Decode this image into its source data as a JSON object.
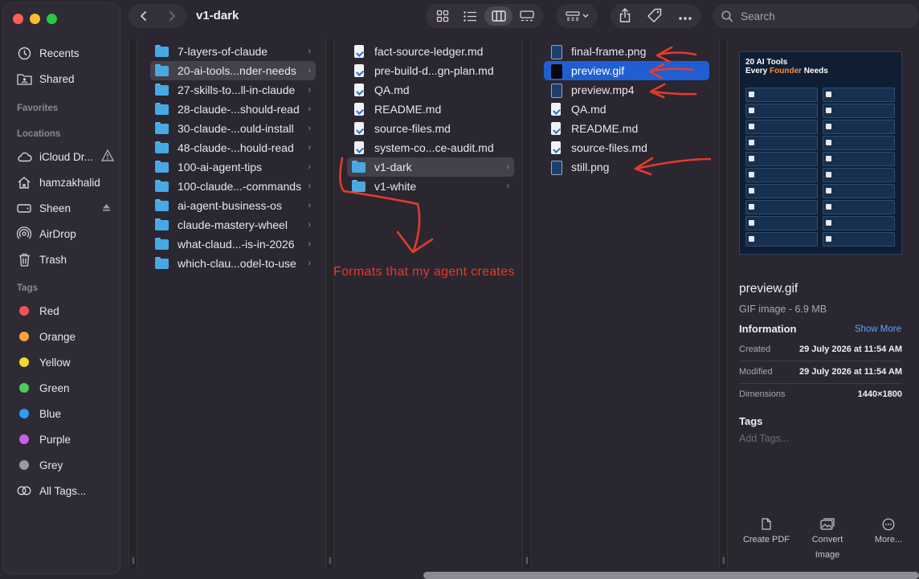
{
  "window": {
    "title": "v1-dark"
  },
  "toolbar": {
    "search_placeholder": "Search"
  },
  "sidebar": {
    "top": [
      {
        "label": "Recents",
        "icon": "clock-icon"
      },
      {
        "label": "Shared",
        "icon": "shared-folder-icon"
      }
    ],
    "favorites_header": "Favorites",
    "locations_header": "Locations",
    "locations": [
      {
        "label": "iCloud Dr...",
        "icon": "cloud-icon"
      },
      {
        "label": "hamzakhalid",
        "icon": "home-icon"
      },
      {
        "label": "Sheen",
        "icon": "drive-icon"
      },
      {
        "label": "AirDrop",
        "icon": "airdrop-icon"
      },
      {
        "label": "Trash",
        "icon": "trash-icon"
      }
    ],
    "tags_header": "Tags",
    "tags": [
      {
        "label": "Red",
        "color": "#f0545b"
      },
      {
        "label": "Orange",
        "color": "#f7a43b"
      },
      {
        "label": "Yellow",
        "color": "#f6d633"
      },
      {
        "label": "Green",
        "color": "#4bcf5a"
      },
      {
        "label": "Blue",
        "color": "#2f9df7"
      },
      {
        "label": "Purple",
        "color": "#c661e6"
      },
      {
        "label": "Grey",
        "color": "#9b99a1"
      }
    ],
    "all_tags": "All Tags..."
  },
  "columns": {
    "col1": [
      "7-layers-of-claude",
      "20-ai-tools...nder-needs",
      "27-skills-to...ll-in-claude",
      "28-claude-...should-read",
      "30-claude-...ould-install",
      "48-claude-...hould-read",
      "100-ai-agent-tips",
      "100-claude...-commands",
      "ai-agent-business-os",
      "claude-mastery-wheel",
      "what-claud...-is-in-2026",
      "which-clau...odel-to-use"
    ],
    "col2_files": [
      "fact-source-ledger.md",
      "pre-build-d...gn-plan.md",
      "QA.md",
      "README.md",
      "source-files.md",
      "system-co...ce-audit.md"
    ],
    "col2_folders": [
      "v1-dark",
      "v1-white"
    ],
    "col3": [
      {
        "name": "final-frame.png",
        "kind": "img"
      },
      {
        "name": "preview.gif",
        "kind": "img-black"
      },
      {
        "name": "preview.mp4",
        "kind": "img"
      },
      {
        "name": "QA.md",
        "kind": "doc"
      },
      {
        "name": "README.md",
        "kind": "doc"
      },
      {
        "name": "source-files.md",
        "kind": "doc"
      },
      {
        "name": "still.png",
        "kind": "img"
      }
    ]
  },
  "annotation": {
    "text": "Formats that my agent creates",
    "color": "#e53b2c"
  },
  "preview": {
    "thumb_title_1": "20 AI Tools",
    "thumb_title_2a": "Every ",
    "thumb_title_2b": "Founder",
    "thumb_title_2c": " Needs",
    "name": "preview.gif",
    "kind": "GIF image - 6.9 MB",
    "info_header": "Information",
    "show_more": "Show More",
    "created_label": "Created",
    "created_value": "29 July 2026 at 11:54 AM",
    "modified_label": "Modified",
    "modified_value": "29 July 2026 at 11:54 AM",
    "dimensions_label": "Dimensions",
    "dimensions_value": "1440×1800",
    "tags_header": "Tags",
    "add_tags": "Add Tags...",
    "actions": [
      {
        "label": "Create PDF"
      },
      {
        "label": "Convert Image"
      },
      {
        "label": "More..."
      }
    ]
  }
}
